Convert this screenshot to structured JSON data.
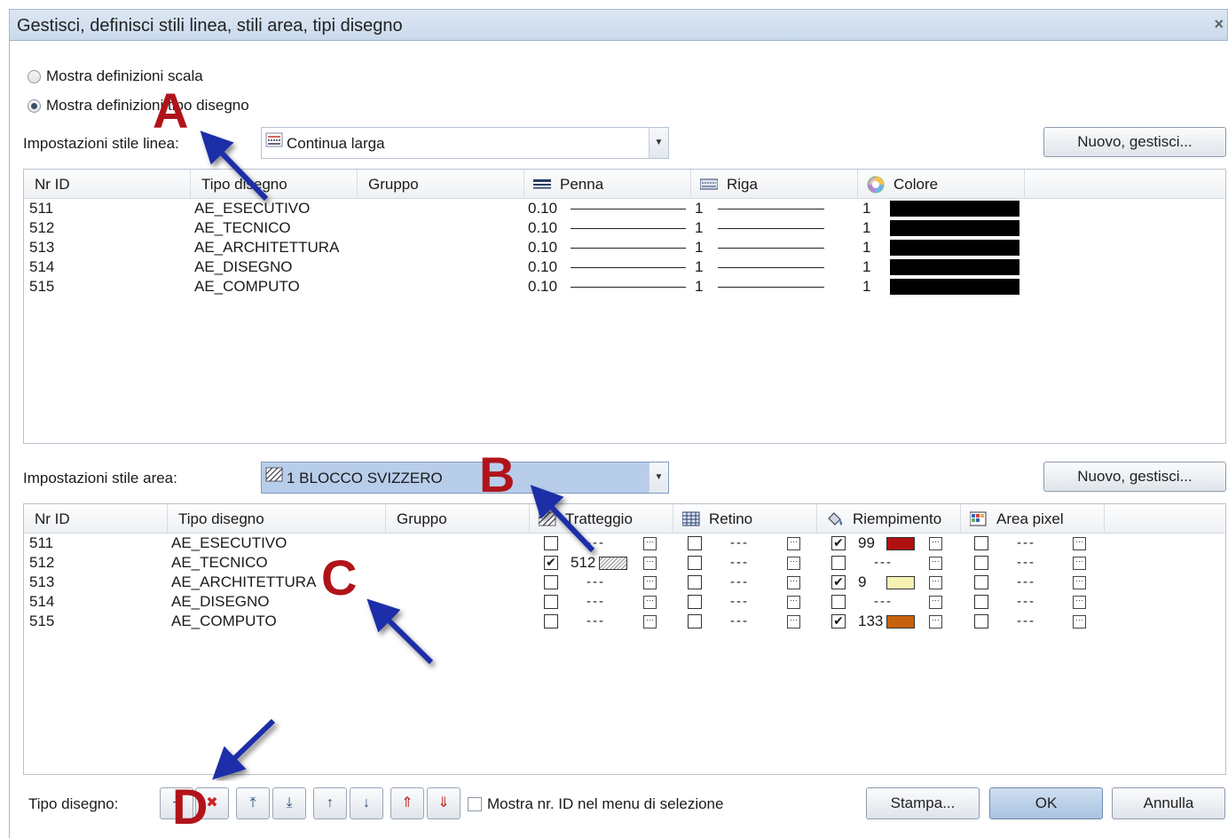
{
  "window": {
    "title": "Gestisci, definisci stili linea, stili area, tipi disegno",
    "close_glyph": "×"
  },
  "radios": [
    {
      "label": "Mostra definizioni scala",
      "selected": false
    },
    {
      "label": "Mostra definizioni tipo disegno",
      "selected": true
    }
  ],
  "line_style": {
    "label": "Impostazioni stile linea:",
    "combo_value": "Continua larga",
    "new_button": "Nuovo, gestisci...",
    "columns": [
      "Nr ID",
      "Tipo disegno",
      "Gruppo",
      "Penna",
      "Riga",
      "Colore"
    ],
    "rows": [
      {
        "id": "511",
        "tipo": "AE_ESECUTIVO",
        "gruppo": "",
        "penna": "0.10",
        "riga": "1",
        "colore": "1",
        "swatch": "#000000"
      },
      {
        "id": "512",
        "tipo": "AE_TECNICO",
        "gruppo": "",
        "penna": "0.10",
        "riga": "1",
        "colore": "1",
        "swatch": "#000000"
      },
      {
        "id": "513",
        "tipo": "AE_ARCHITETTURA",
        "gruppo": "",
        "penna": "0.10",
        "riga": "1",
        "colore": "1",
        "swatch": "#000000"
      },
      {
        "id": "514",
        "tipo": "AE_DISEGNO",
        "gruppo": "",
        "penna": "0.10",
        "riga": "1",
        "colore": "1",
        "swatch": "#000000"
      },
      {
        "id": "515",
        "tipo": "AE_COMPUTO",
        "gruppo": "",
        "penna": "0.10",
        "riga": "1",
        "colore": "1",
        "swatch": "#000000"
      }
    ]
  },
  "area_style": {
    "label": "Impostazioni stile area:",
    "combo_value": "1 BLOCCO SVIZZERO",
    "new_button": "Nuovo, gestisci...",
    "columns": [
      "Nr ID",
      "Tipo disegno",
      "Gruppo",
      "Tratteggio",
      "Retino",
      "Riempimento",
      "Area pixel"
    ],
    "rows": [
      {
        "id": "511",
        "tipo": "AE_ESECUTIVO",
        "trat_on": false,
        "trat_val": "---",
        "ret_on": false,
        "ret_val": "---",
        "riemp_on": true,
        "riemp_val": "99",
        "riemp_color": "#b01010",
        "pix_on": false,
        "pix_val": "---"
      },
      {
        "id": "512",
        "tipo": "AE_TECNICO",
        "trat_on": true,
        "trat_val": "512",
        "ret_on": false,
        "ret_val": "---",
        "riemp_on": false,
        "riemp_val": "---",
        "riemp_color": "",
        "pix_on": false,
        "pix_val": "---"
      },
      {
        "id": "513",
        "tipo": "AE_ARCHITETTURA",
        "trat_on": false,
        "trat_val": "---",
        "ret_on": false,
        "ret_val": "---",
        "riemp_on": true,
        "riemp_val": "9",
        "riemp_color": "#f6f2b4",
        "pix_on": false,
        "pix_val": "---"
      },
      {
        "id": "514",
        "tipo": "AE_DISEGNO",
        "trat_on": false,
        "trat_val": "---",
        "ret_on": false,
        "ret_val": "---",
        "riemp_on": false,
        "riemp_val": "---",
        "riemp_color": "",
        "pix_on": false,
        "pix_val": "---"
      },
      {
        "id": "515",
        "tipo": "AE_COMPUTO",
        "trat_on": false,
        "trat_val": "---",
        "ret_on": false,
        "ret_val": "---",
        "riemp_on": true,
        "riemp_val": "133",
        "riemp_color": "#c8620e",
        "pix_on": false,
        "pix_val": "---"
      }
    ]
  },
  "footer": {
    "tipo_label": "Tipo disegno:",
    "show_id_label": "Mostra nr. ID nel menu di selezione",
    "show_id_checked": false,
    "print_button": "Stampa...",
    "ok_button": "OK",
    "cancel_button": "Annulla"
  },
  "annotations": [
    "A",
    "B",
    "C",
    "D"
  ],
  "colors": {
    "arrow": "#1c2fa8",
    "annotation": "#b0141a",
    "selected_combo": "#b8cdea"
  }
}
